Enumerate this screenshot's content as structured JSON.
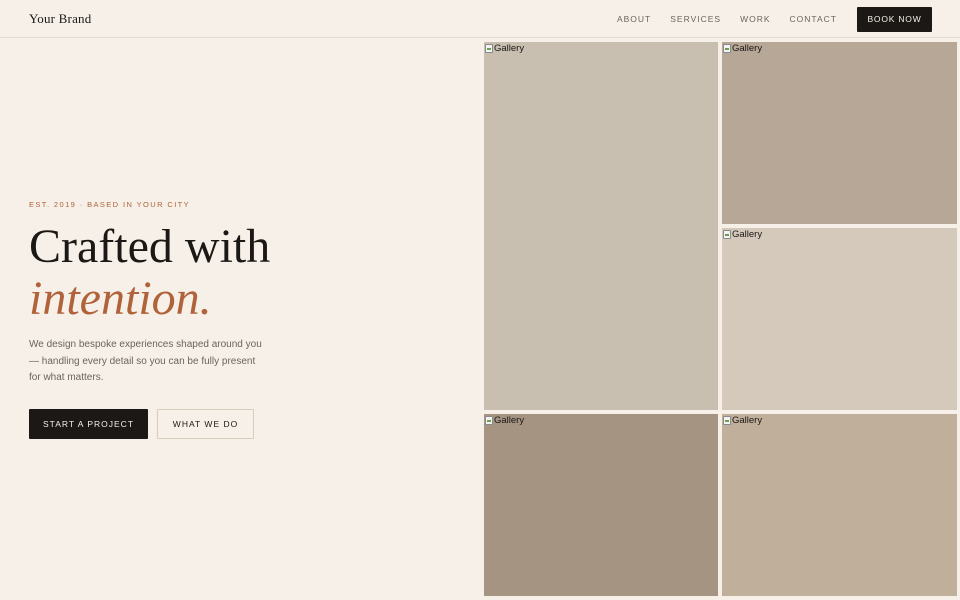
{
  "nav": {
    "brand": "Your Brand",
    "links": [
      {
        "label": "ABOUT"
      },
      {
        "label": "SERVICES"
      },
      {
        "label": "WORK"
      },
      {
        "label": "CONTACT"
      }
    ],
    "cta": "BOOK NOW"
  },
  "hero": {
    "eyebrow": "EST. 2019 · BASED IN YOUR CITY",
    "headline_line1": "Crafted with",
    "headline_accent": "intention.",
    "description": "We design bespoke experiences shaped around you — handling every detail so you can be fully present for what matters.",
    "primary_button": "START A PROJECT",
    "secondary_button": "WHAT WE DO"
  },
  "gallery": [
    {
      "alt": "Gallery",
      "color": "#c9bfb1"
    },
    {
      "alt": "Gallery",
      "color": "#b7a797"
    },
    {
      "alt": "Gallery",
      "color": "#d4c9bb"
    },
    {
      "alt": "Gallery",
      "color": "#a69483"
    },
    {
      "alt": "Gallery",
      "color": "#c0af9b"
    }
  ],
  "colors": {
    "background": "#f6f0e8",
    "ink": "#1b1815",
    "accent": "#b0623a",
    "muted": "#6b645d"
  }
}
